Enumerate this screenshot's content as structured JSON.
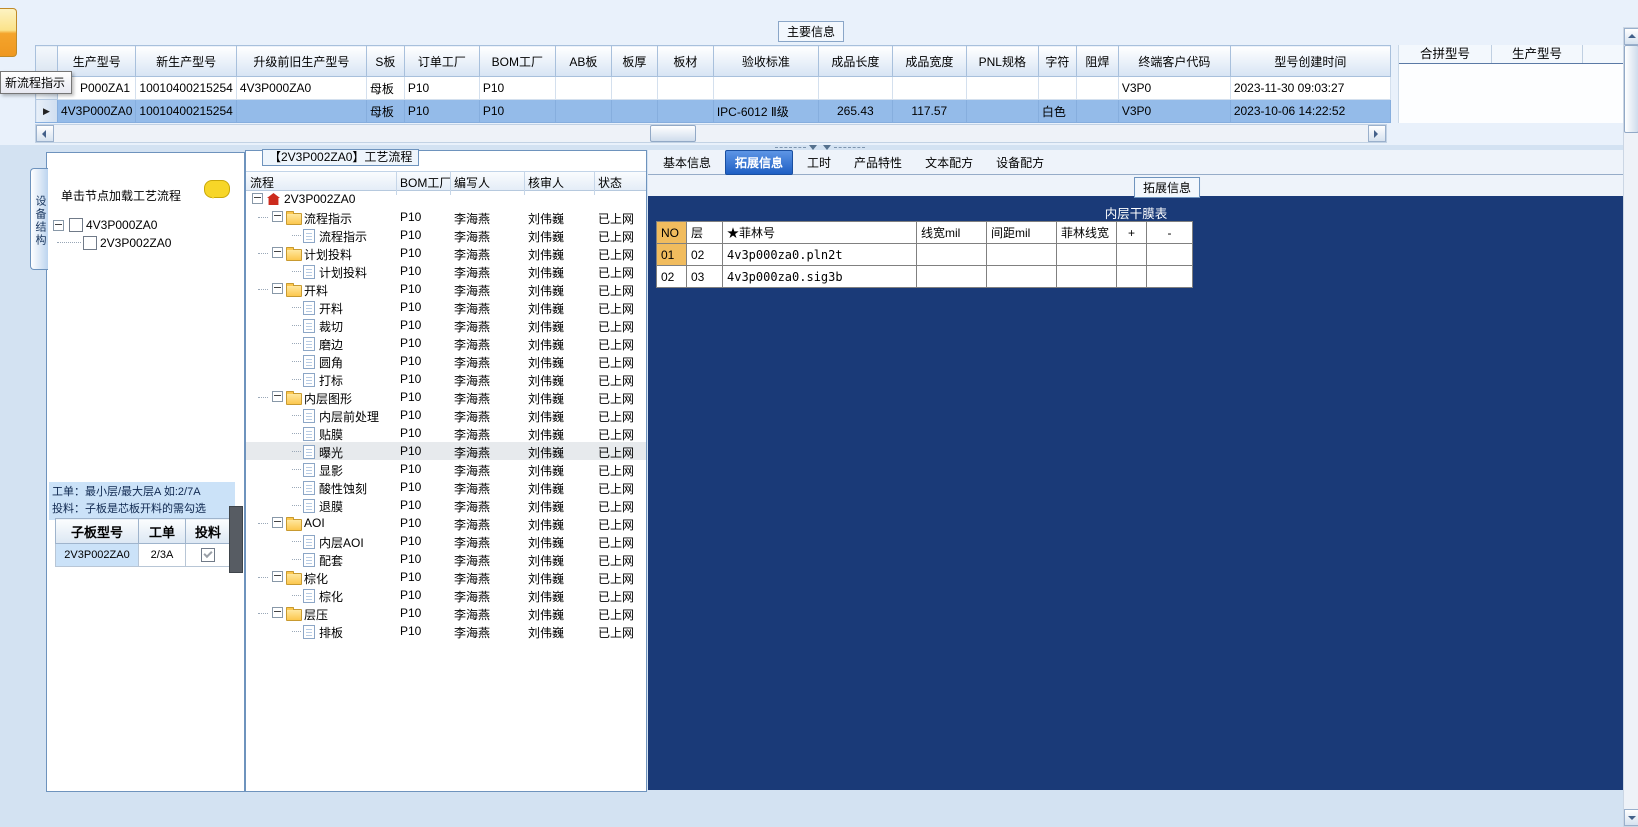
{
  "window": {
    "main_info_label": "主要信息",
    "tooltip": "新流程指示"
  },
  "main_grid": {
    "columns": [
      "生产型号",
      "新生产型号",
      "升级前旧生产型号",
      "S板",
      "订单工厂",
      "BOM工厂",
      "AB板",
      "板厚",
      "板材",
      "验收标准",
      "成品长度",
      "成品宽度",
      "PNL规格",
      "字符",
      "阻焊",
      "终端客户代码",
      "型号创建时间"
    ],
    "rows": [
      {
        "selected": false,
        "cells": [
          "P000ZA1",
          "10010400215254",
          "4V3P000ZA0",
          "母板",
          "P10",
          "P10",
          "",
          "",
          "",
          "",
          "",
          "",
          "",
          "",
          "",
          "V3P0",
          "2023-11-30 09:03:27"
        ]
      },
      {
        "selected": true,
        "cells": [
          "4V3P000ZA0",
          "10010400215254",
          "",
          "母板",
          "P10",
          "P10",
          "",
          "",
          "",
          "IPC-6012 Ⅱ级",
          "265.43",
          "117.57",
          "",
          "白色",
          "",
          "V3P0",
          "2023-10-06 14:22:52"
        ]
      }
    ]
  },
  "right_grid": {
    "columns": [
      "合拼型号",
      "生产型号"
    ]
  },
  "left_panel": {
    "vertical_tab": "设备结构",
    "hint": "单击节点加载工艺流程",
    "tree": [
      {
        "label": "4V3P000ZA0",
        "checked": false
      },
      {
        "label": "2V3P002ZA0",
        "checked": false
      }
    ],
    "note_line1": "工单：最小层/最大层A 如:2/7A",
    "note_line2": "投料：子板是芯板开料的需勾选",
    "board_table": {
      "columns": [
        "子板型号",
        "工单",
        "投料"
      ],
      "rows": [
        {
          "model": "2V3P002ZA0",
          "work_order": "2/3A",
          "feed_checked": true
        }
      ]
    }
  },
  "process_panel": {
    "title": "【2V3P002ZA0】工艺流程",
    "columns": [
      "流程",
      "BOM工厂",
      "编写人",
      "核审人",
      "状态"
    ],
    "rows": [
      {
        "label": "2V3P002ZA0",
        "type": "root",
        "cols": [
          "",
          "",
          "",
          ""
        ]
      },
      {
        "label": "流程指示",
        "type": "folder",
        "cols": [
          "P10",
          "李海燕",
          "刘伟巍",
          "已上网"
        ]
      },
      {
        "label": "流程指示",
        "type": "leaf",
        "cols": [
          "P10",
          "李海燕",
          "刘伟巍",
          "已上网"
        ]
      },
      {
        "label": "计划投料",
        "type": "folder",
        "cols": [
          "P10",
          "李海燕",
          "刘伟巍",
          "已上网"
        ]
      },
      {
        "label": "计划投料",
        "type": "leaf",
        "cols": [
          "P10",
          "李海燕",
          "刘伟巍",
          "已上网"
        ]
      },
      {
        "label": "开料",
        "type": "folder",
        "cols": [
          "P10",
          "李海燕",
          "刘伟巍",
          "已上网"
        ]
      },
      {
        "label": "开料",
        "type": "leaf",
        "cols": [
          "P10",
          "李海燕",
          "刘伟巍",
          "已上网"
        ]
      },
      {
        "label": "裁切",
        "type": "leaf",
        "cols": [
          "P10",
          "李海燕",
          "刘伟巍",
          "已上网"
        ]
      },
      {
        "label": "磨边",
        "type": "leaf",
        "cols": [
          "P10",
          "李海燕",
          "刘伟巍",
          "已上网"
        ]
      },
      {
        "label": "圆角",
        "type": "leaf",
        "cols": [
          "P10",
          "李海燕",
          "刘伟巍",
          "已上网"
        ]
      },
      {
        "label": "打标",
        "type": "leaf",
        "cols": [
          "P10",
          "李海燕",
          "刘伟巍",
          "已上网"
        ]
      },
      {
        "label": "内层图形",
        "type": "folder",
        "cols": [
          "P10",
          "李海燕",
          "刘伟巍",
          "已上网"
        ]
      },
      {
        "label": "内层前处理",
        "type": "leaf",
        "cols": [
          "P10",
          "李海燕",
          "刘伟巍",
          "已上网"
        ]
      },
      {
        "label": "贴膜",
        "type": "leaf",
        "cols": [
          "P10",
          "李海燕",
          "刘伟巍",
          "已上网"
        ]
      },
      {
        "label": "曝光",
        "type": "leaf",
        "selected": true,
        "cols": [
          "P10",
          "李海燕",
          "刘伟巍",
          "已上网"
        ]
      },
      {
        "label": "显影",
        "type": "leaf",
        "cols": [
          "P10",
          "李海燕",
          "刘伟巍",
          "已上网"
        ]
      },
      {
        "label": "酸性蚀刻",
        "type": "leaf",
        "cols": [
          "P10",
          "李海燕",
          "刘伟巍",
          "已上网"
        ]
      },
      {
        "label": "退膜",
        "type": "leaf",
        "cols": [
          "P10",
          "李海燕",
          "刘伟巍",
          "已上网"
        ]
      },
      {
        "label": "AOI",
        "type": "folder",
        "cols": [
          "P10",
          "李海燕",
          "刘伟巍",
          "已上网"
        ]
      },
      {
        "label": "内层AOI",
        "type": "leaf",
        "cols": [
          "P10",
          "李海燕",
          "刘伟巍",
          "已上网"
        ]
      },
      {
        "label": "配套",
        "type": "leaf",
        "cols": [
          "P10",
          "李海燕",
          "刘伟巍",
          "已上网"
        ]
      },
      {
        "label": "棕化",
        "type": "folder",
        "cols": [
          "P10",
          "李海燕",
          "刘伟巍",
          "已上网"
        ]
      },
      {
        "label": "棕化",
        "type": "leaf",
        "cols": [
          "P10",
          "李海燕",
          "刘伟巍",
          "已上网"
        ]
      },
      {
        "label": "层压",
        "type": "folder",
        "cols": [
          "P10",
          "李海燕",
          "刘伟巍",
          "已上网"
        ]
      },
      {
        "label": "排板",
        "type": "leaf",
        "cols": [
          "P10",
          "李海燕",
          "刘伟巍",
          "已上网"
        ]
      }
    ]
  },
  "detail_panel": {
    "tabs": [
      "基本信息",
      "拓展信息",
      "工时",
      "产品特性",
      "文本配方",
      "设备配方"
    ],
    "active_tab": "拓展信息",
    "group_label": "拓展信息",
    "table_title": "内层干膜表",
    "film_table": {
      "columns": [
        "NO",
        "层",
        "★菲林号",
        "线宽mil",
        "间距mil",
        "菲林线宽",
        "+",
        "-"
      ],
      "rows": [
        [
          "01",
          "02",
          "4v3p000za0.pln2t",
          "",
          "",
          "",
          "",
          ""
        ],
        [
          "02",
          "03",
          "4v3p000za0.sig3b",
          "",
          "",
          "",
          "",
          ""
        ]
      ]
    }
  },
  "colors": {
    "accent_blue": "#1e5fc4",
    "selected_row": "#94bbe9",
    "panel_dark_blue": "#1a3a78",
    "highlight_orange": "#f1bc5e",
    "note_bg": "#cbe2f8",
    "status_text": "#000000"
  }
}
